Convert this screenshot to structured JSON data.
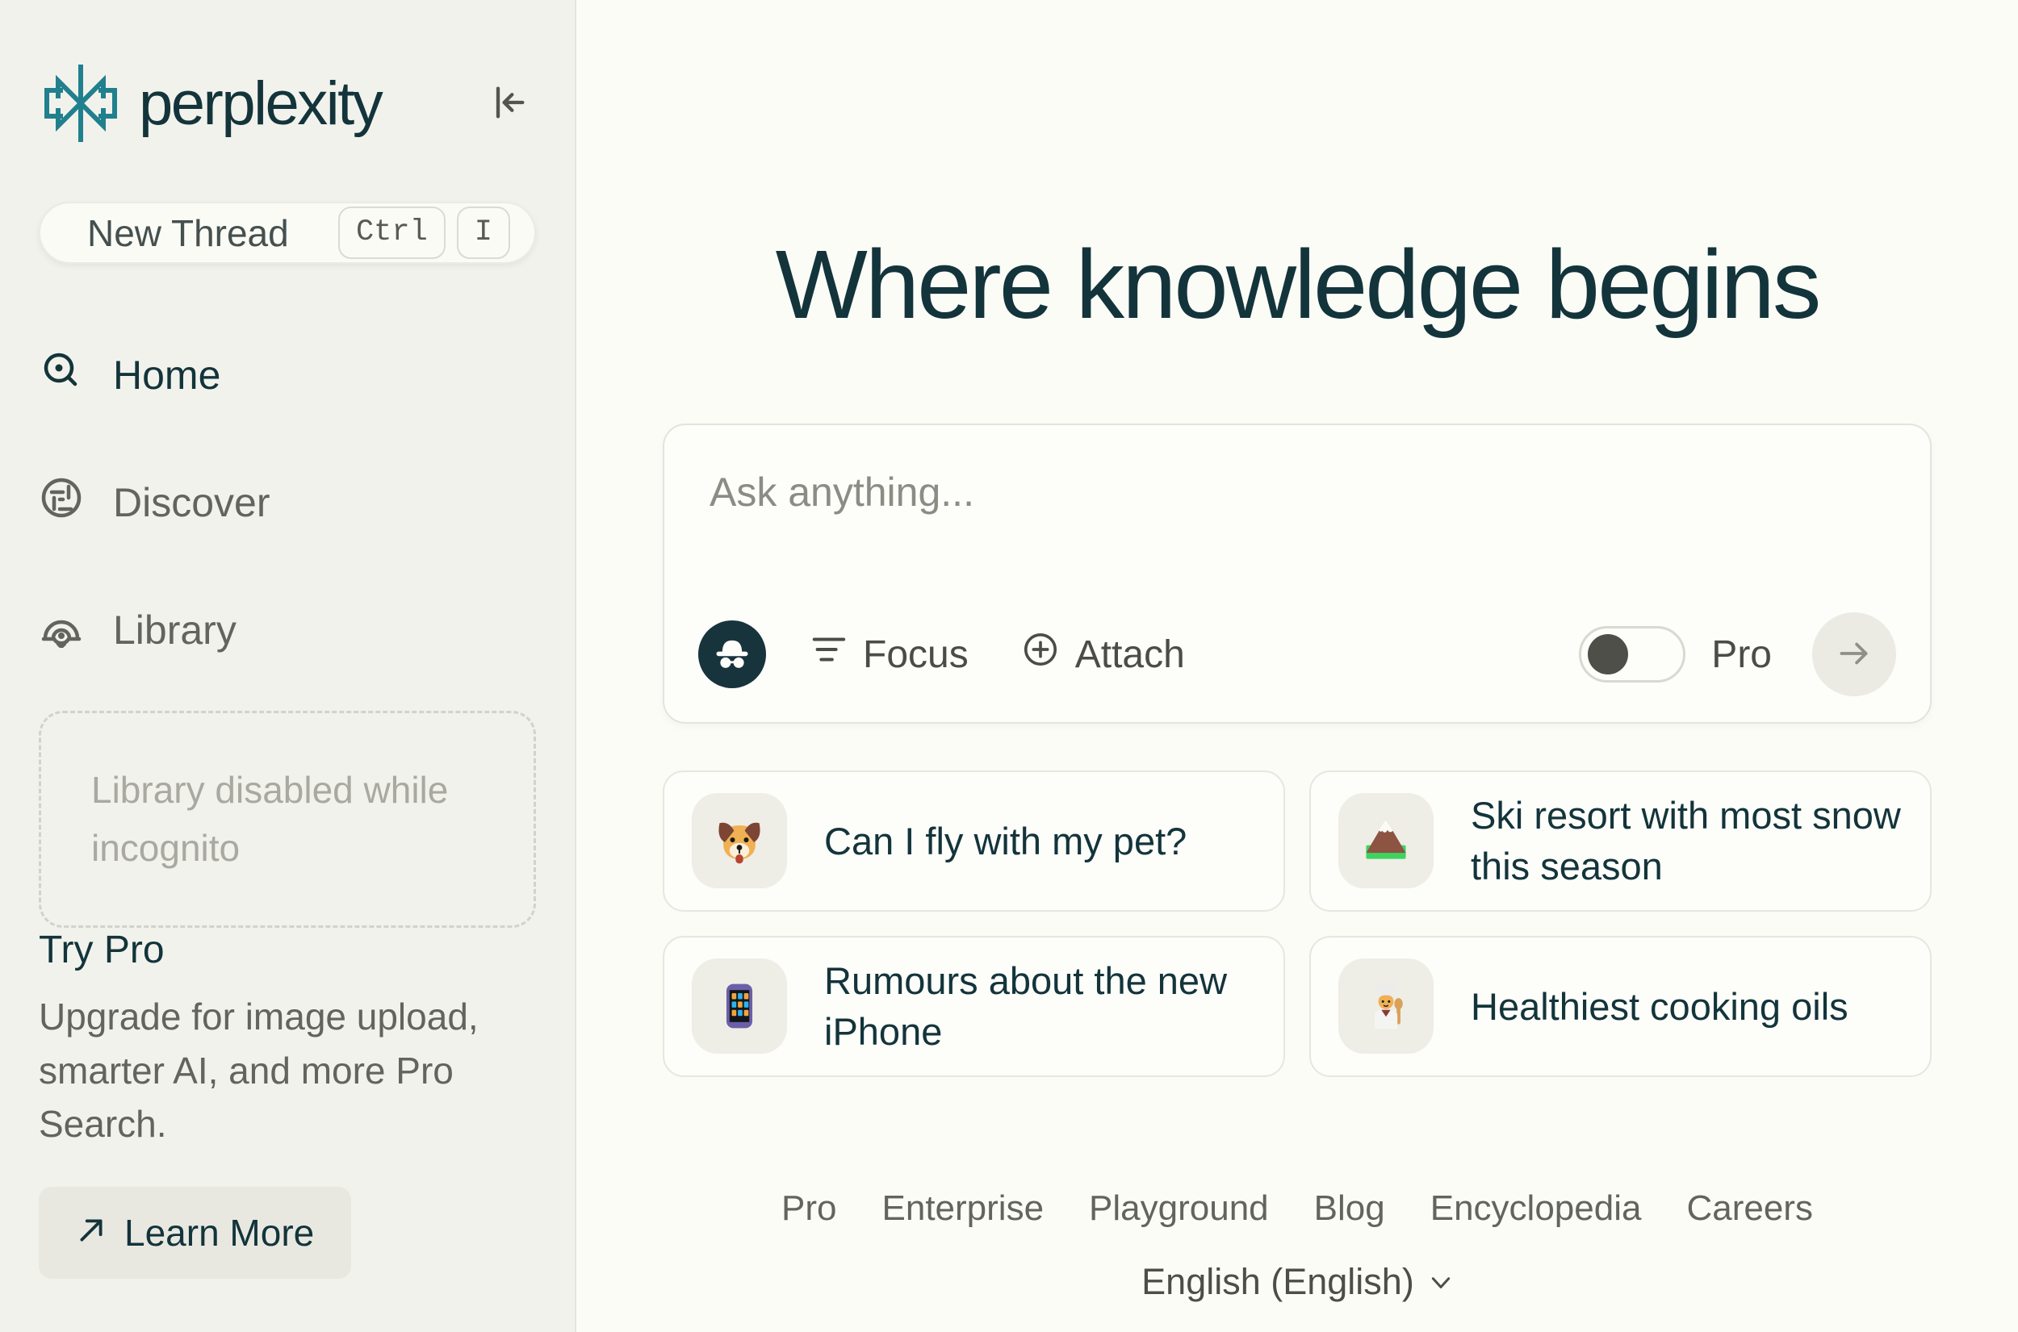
{
  "sidebar": {
    "brand": "perplexity",
    "logo_icon": "perplexity-logo-icon",
    "collapse_icon": "collapse-sidebar-icon",
    "new_thread": {
      "label": "New Thread",
      "shortcut_keys": [
        "Ctrl",
        "I"
      ]
    },
    "nav": [
      {
        "label": "Home",
        "icon": "home-icon",
        "active": true
      },
      {
        "label": "Discover",
        "icon": "discover-icon",
        "active": false
      },
      {
        "label": "Library",
        "icon": "library-icon",
        "active": false
      }
    ],
    "library_notice": "Library disabled while incognito",
    "try_pro": {
      "title": "Try Pro",
      "description": "Upgrade for image upload, smarter AI, and more Pro Search.",
      "cta": "Learn More",
      "cta_icon": "north-east-arrow-icon"
    }
  },
  "main": {
    "title": "Where knowledge begins",
    "search": {
      "placeholder": "Ask anything...",
      "incognito_icon": "incognito-icon",
      "focus_label": "Focus",
      "focus_icon": "focus-filter-icon",
      "attach_label": "Attach",
      "attach_icon": "attach-plus-icon",
      "pro_label": "Pro",
      "pro_toggle_state": "off",
      "submit_icon": "arrow-right-icon"
    },
    "suggestions": [
      {
        "icon": "dog-face-emoji",
        "label": "Can I fly with my pet?"
      },
      {
        "icon": "snow-capped-mountain-emoji",
        "label": "Ski resort with most snow this season"
      },
      {
        "icon": "mobile-phone-emoji",
        "label": "Rumours about the new iPhone"
      },
      {
        "icon": "cook-emoji",
        "label": "Healthiest cooking oils"
      }
    ],
    "footer": {
      "links": [
        "Pro",
        "Enterprise",
        "Playground",
        "Blog",
        "Encyclopedia",
        "Careers"
      ],
      "language": "English (English)",
      "language_icon": "chevron-down-icon"
    }
  },
  "colors": {
    "brand_teal": "#20808d",
    "offblack": "#13343b",
    "background": "#fcfcf7",
    "sidebar_background": "#f2f2ec"
  }
}
